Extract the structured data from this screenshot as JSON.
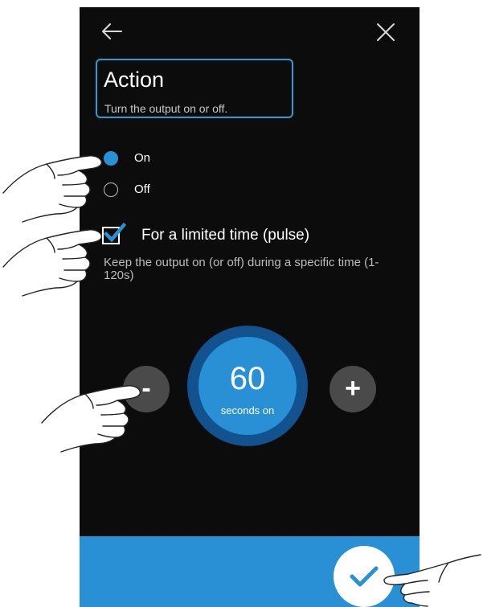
{
  "icons": {
    "back": "arrow-left-icon",
    "close": "close-icon",
    "check": "checkmark-icon",
    "confirm": "checkmark-icon",
    "pointer": "pointing-hand-icon"
  },
  "colors": {
    "background": "#0c0c0c",
    "accent": "#2a90d6",
    "dial_ring": "#12528f",
    "step_button": "#4a4a4a",
    "highlight_border": "#2a9ad8"
  },
  "header": {
    "title": "Action",
    "subtitle": "Turn the output on or off."
  },
  "state_options": [
    {
      "label": "On",
      "selected": true
    },
    {
      "label": "Off",
      "selected": false
    }
  ],
  "pulse": {
    "label": "For a limited time (pulse)",
    "checked": true,
    "description": "Keep the output on (or off) during a specific time (1-120s)"
  },
  "duration": {
    "value": "60",
    "unit": "seconds on",
    "decrement_label": "-",
    "increment_label": "+"
  }
}
